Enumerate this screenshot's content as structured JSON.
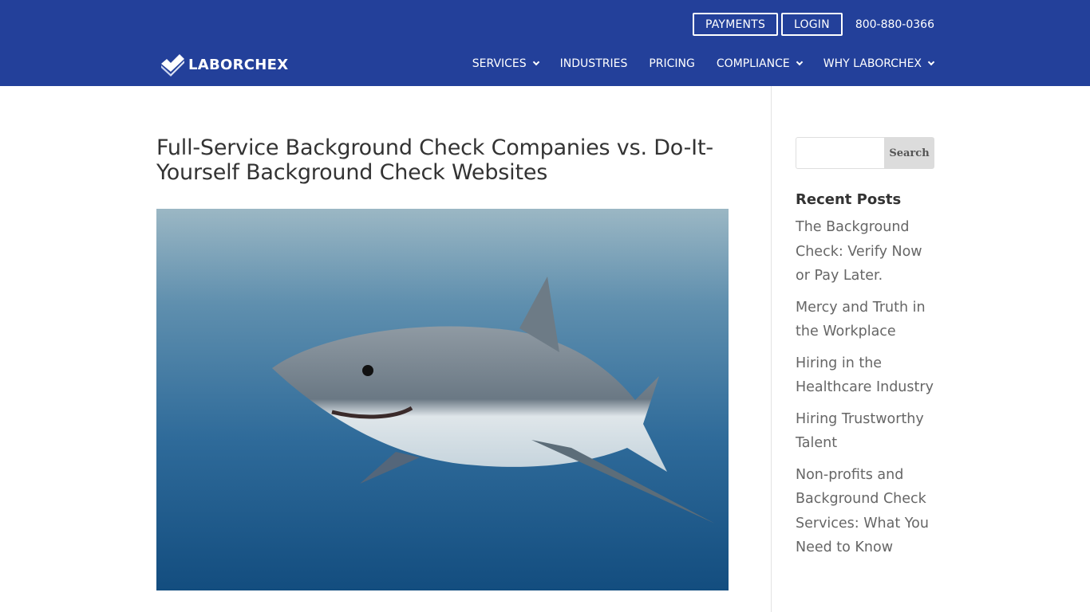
{
  "header": {
    "brand": "LABORCHEX",
    "top_buttons": [
      "PAYMENTS",
      "LOGIN"
    ],
    "phone": "800-880-0366",
    "nav": [
      {
        "label": "SERVICES",
        "dropdown": true
      },
      {
        "label": "INDUSTRIES",
        "dropdown": false
      },
      {
        "label": "PRICING",
        "dropdown": false
      },
      {
        "label": "COMPLIANCE",
        "dropdown": true
      },
      {
        "label": "WHY LABORCHEX",
        "dropdown": true
      }
    ],
    "color": "#23409a"
  },
  "article": {
    "title": "Full-Service Background Check Companies vs. Do-It-Yourself Background Check Websites",
    "image_alt": "great white shark underwater"
  },
  "sidebar": {
    "search": {
      "placeholder": "",
      "value": "",
      "button": "Search"
    },
    "recent_title": "Recent Posts",
    "posts": [
      "The Background Check: Verify Now or Pay Later.",
      "Mercy and Truth in the Workplace",
      "Hiring in the Healthcare Industry",
      "Hiring Trustworthy Talent",
      "Non-profits and Background Check Services: What You Need to Know"
    ]
  }
}
